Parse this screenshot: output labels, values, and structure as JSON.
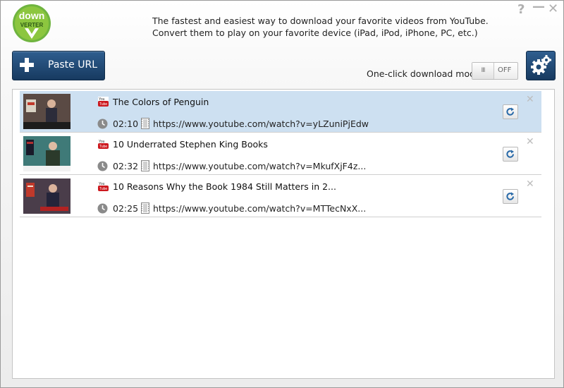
{
  "app": {
    "logo_text_top": "down",
    "logo_text_bottom": "VERTER",
    "tagline_line1": "The fastest and easiest way to download your favorite videos from YouTube.",
    "tagline_line2": "Convert them to play on your favorite device (iPad, iPod, iPhone, PC, etc.)",
    "help_glyph": "?",
    "minimize_glyph": "—",
    "close_glyph": "✕"
  },
  "toolbar": {
    "paste_label": "Paste URL",
    "oneclick_label": "One-click download mode",
    "toggle_knob": "III",
    "toggle_state": "OFF"
  },
  "videos": [
    {
      "title": "The Colors of Penguin",
      "duration": "02:10",
      "url": "https://www.youtube.com/watch?v=yLZuniPjEdw",
      "selected": true
    },
    {
      "title": "10 Underrated Stephen King Books",
      "duration": "02:32",
      "url": "https://www.youtube.com/watch?v=MkufXjF4z...",
      "selected": false
    },
    {
      "title": "10 Reasons Why the Book 1984 Still Matters in 2...",
      "duration": "02:25",
      "url": "https://www.youtube.com/watch?v=MTTecNxX...",
      "selected": false
    }
  ],
  "colors": {
    "accent": "#1f4a75",
    "selection": "#cde0f1",
    "logo_green": "#6fb43f"
  }
}
